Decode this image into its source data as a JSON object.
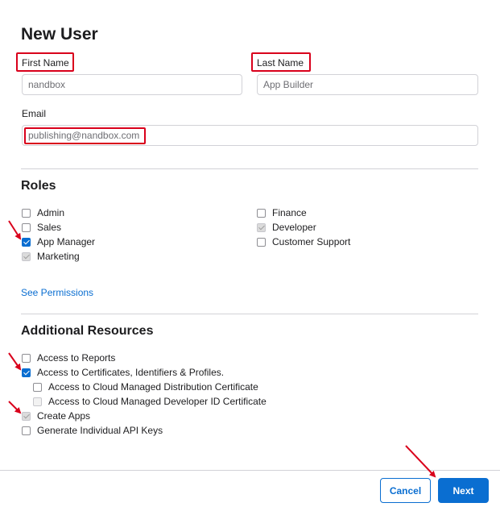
{
  "title": "New User",
  "form": {
    "first_name_label": "First Name",
    "first_name_value": "nandbox",
    "last_name_label": "Last Name",
    "last_name_value": "App Builder",
    "email_label": "Email",
    "email_value": "publishing@nandbox.com"
  },
  "roles": {
    "title": "Roles",
    "items": [
      {
        "label": "Admin",
        "state": "unchecked"
      },
      {
        "label": "Sales",
        "state": "unchecked"
      },
      {
        "label": "App Manager",
        "state": "checked"
      },
      {
        "label": "Marketing",
        "state": "disabled-checked"
      },
      {
        "label": "Finance",
        "state": "unchecked"
      },
      {
        "label": "Developer",
        "state": "disabled-checked"
      },
      {
        "label": "Customer Support",
        "state": "unchecked"
      }
    ],
    "see_permissions": "See Permissions"
  },
  "resources": {
    "title": "Additional Resources",
    "items": [
      {
        "label": "Access to Reports",
        "state": "unchecked"
      },
      {
        "label": "Access to Certificates, Identifiers & Profiles.",
        "state": "checked"
      },
      {
        "label": "Access to Cloud Managed Distribution Certificate",
        "state": "unchecked"
      },
      {
        "label": "Access to Cloud Managed Developer ID Certificate",
        "state": "disabled-unchecked"
      },
      {
        "label": "Create Apps",
        "state": "disabled-checked"
      },
      {
        "label": "Generate Individual API Keys",
        "state": "unchecked"
      }
    ]
  },
  "footer": {
    "cancel_label": "Cancel",
    "next_label": "Next"
  },
  "colors": {
    "accent": "#0a6ed1",
    "annotation": "#d9001b"
  }
}
